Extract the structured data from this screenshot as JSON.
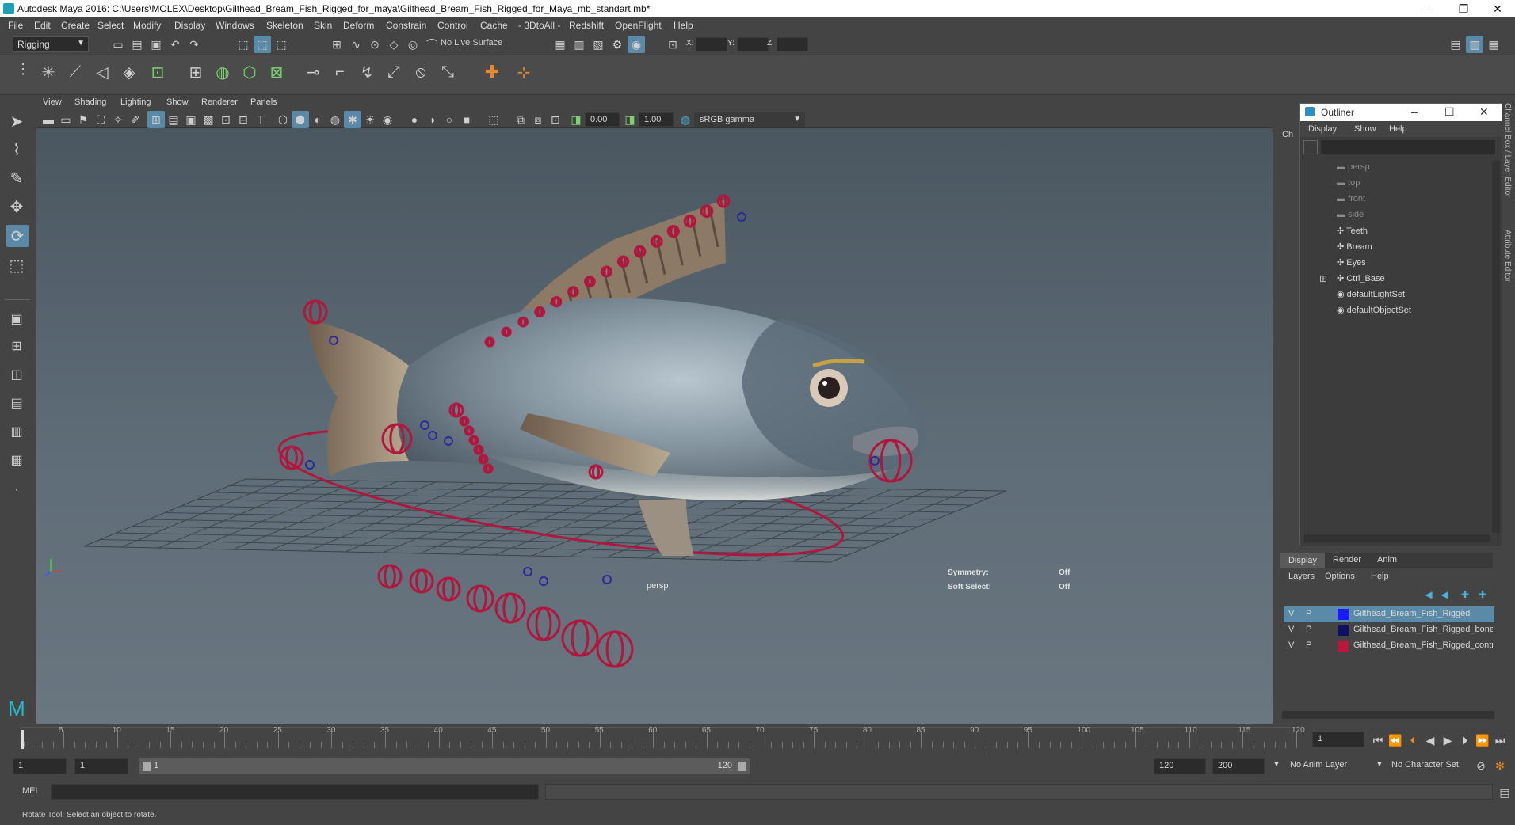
{
  "window": {
    "title": "Autodesk Maya 2016: C:\\Users\\MOLEX\\Desktop\\Gilthead_Bream_Fish_Rigged_for_maya\\Gilthead_Bream_Fish_Rigged_for_Maya_mb_standart.mb*",
    "controls": [
      "–",
      "❐",
      "✕"
    ]
  },
  "menubar": [
    "File",
    "Edit",
    "Create",
    "Select",
    "Modify",
    "Display",
    "Windows",
    "Skeleton",
    "Skin",
    "Deform",
    "Constrain",
    "Control",
    "Cache",
    "- 3DtoAll -",
    "Redshift",
    "OpenFlight",
    "Help"
  ],
  "statusline": {
    "mode": "Rigging",
    "live_surface": "No Live Surface",
    "x_label": "X:",
    "y_label": "Y:",
    "z_label": "Z:"
  },
  "viewport": {
    "menus": [
      "View",
      "Shading",
      "Lighting",
      "Show",
      "Renderer",
      "Panels"
    ],
    "exposure": "0.00",
    "gamma": "1.00",
    "colorspace": "sRGB gamma",
    "camera_label": "persp",
    "symmetry_label": "Symmetry:",
    "symmetry_value": "Off",
    "soft_select_label": "Soft Select:",
    "soft_select_value": "Off"
  },
  "outliner": {
    "title": "Outliner",
    "menus": [
      "Display",
      "Show",
      "Help"
    ],
    "side_tab": "Ch",
    "items": [
      {
        "label": "persp",
        "dim": true
      },
      {
        "label": "top",
        "dim": true
      },
      {
        "label": "front",
        "dim": true
      },
      {
        "label": "side",
        "dim": true
      },
      {
        "label": "Teeth",
        "dim": false
      },
      {
        "label": "Bream",
        "dim": false
      },
      {
        "label": "Eyes",
        "dim": false
      },
      {
        "label": "Ctrl_Base",
        "dim": false
      },
      {
        "label": "defaultLightSet",
        "dim": false
      },
      {
        "label": "defaultObjectSet",
        "dim": false
      }
    ]
  },
  "layer_editor": {
    "tabs": [
      "Display",
      "Render",
      "Anim"
    ],
    "menus": [
      "Layers",
      "Options",
      "Help"
    ],
    "layers": [
      {
        "v": "V",
        "p": "P",
        "color": "#1a1aff",
        "name": "Gilthead_Bream_Fish_Rigged",
        "selected": true
      },
      {
        "v": "V",
        "p": "P",
        "color": "#101060",
        "name": "Gilthead_Bream_Fish_Rigged_bones",
        "selected": false
      },
      {
        "v": "V",
        "p": "P",
        "color": "#c0143c",
        "name": "Gilthead_Bream_Fish_Rigged_controllers",
        "selected": false
      }
    ]
  },
  "side_tabs": [
    "Channel Box / Layer Editor",
    "Attribute Editor"
  ],
  "timeline": {
    "ticks": [
      "5",
      "10",
      "15",
      "20",
      "25",
      "30",
      "35",
      "40",
      "45",
      "50",
      "55",
      "60",
      "65",
      "70",
      "75",
      "80",
      "85",
      "90",
      "95",
      "100",
      "105",
      "110",
      "115",
      "120"
    ],
    "start_label": "1",
    "current_frame": "1"
  },
  "range": {
    "start": "1",
    "playback_start": "1",
    "slider_start": "1",
    "slider_end": "120",
    "playback_end": "120",
    "end": "200",
    "anim_layer": "No Anim Layer",
    "character_set": "No Character Set"
  },
  "command": {
    "lang": "MEL"
  },
  "help_line": "Rotate Tool: Select an object to rotate."
}
